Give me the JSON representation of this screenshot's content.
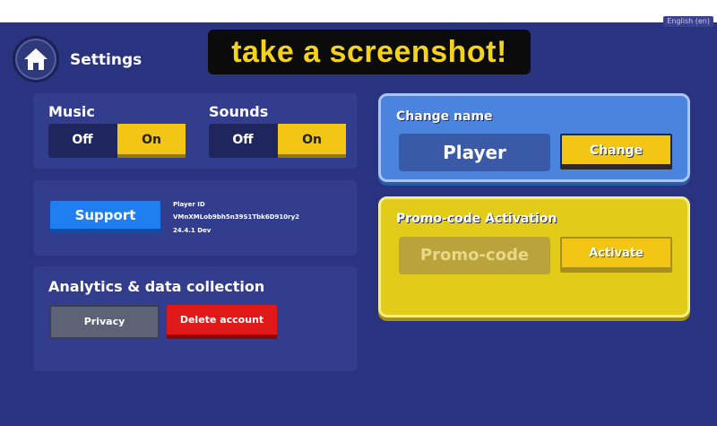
{
  "top": {
    "language": "English (en)"
  },
  "header": {
    "title": "Settings",
    "home_icon": "home-icon"
  },
  "banner": {
    "text": "take a screenshot!"
  },
  "audio": {
    "music_label": "Music",
    "sounds_label": "Sounds",
    "off_label": "Off",
    "on_label": "On"
  },
  "support": {
    "button_label": "Support",
    "player_id_label": "Player ID",
    "player_id_value": "VMnXMLob9bh5n39S1Tbk6D910ry2",
    "version": "24.4.1 Dev"
  },
  "analytics": {
    "title": "Analytics & data collection",
    "privacy_label": "Privacy",
    "delete_label": "Delete account"
  },
  "change_name": {
    "title": "Change name",
    "current_name": "Player",
    "button_label": "Change"
  },
  "promo": {
    "title": "Promo-code Activation",
    "placeholder": "Promo-code",
    "button_label": "Activate"
  },
  "colors": {
    "background": "#2a3380",
    "panel": "#323d8e",
    "accent_yellow": "#f3c514",
    "support_blue": "#1f7ff0",
    "delete_red": "#e01818",
    "name_panel_blue": "#4a84df",
    "promo_panel_yellow": "#e3cb1a"
  }
}
